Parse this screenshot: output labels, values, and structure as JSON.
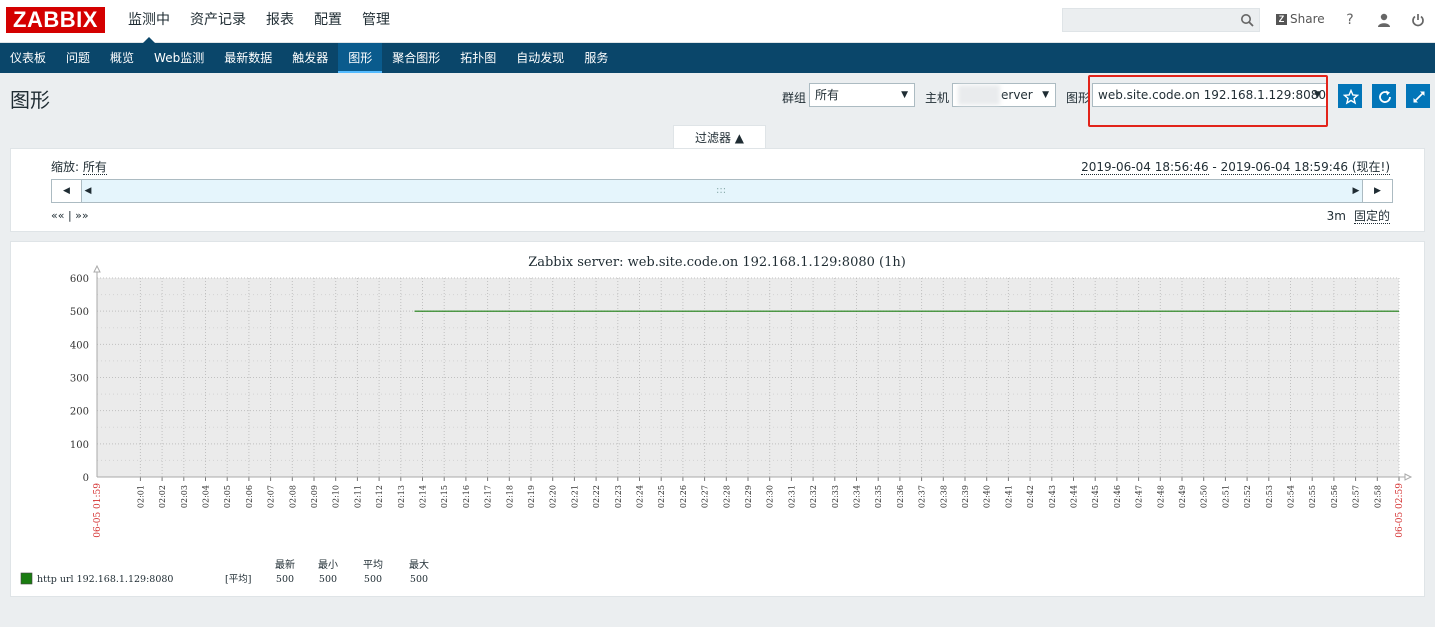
{
  "header": {
    "logo": "ZABBIX",
    "nav": [
      "监测中",
      "资产记录",
      "报表",
      "配置",
      "管理"
    ],
    "share_label": "Share",
    "help_label": "?"
  },
  "subnav": [
    "仪表板",
    "问题",
    "概览",
    "Web监测",
    "最新数据",
    "触发器",
    "图形",
    "聚合图形",
    "拓扑图",
    "自动发现",
    "服务"
  ],
  "page": {
    "title": "图形",
    "group_label": "群组",
    "group_value": "所有",
    "host_label": "主机",
    "host_value": "erver",
    "graph_label": "图形",
    "graph_value": "web.site.code.on 192.168.1.129:8080"
  },
  "filter": {
    "tab_label": "过滤器 ▲",
    "zoom_label": "缩放:",
    "zoom_value": "所有",
    "range_from": "2019-06-04 18:56:46",
    "range_sep": " - ",
    "range_to": "2019-06-04 18:59:46 (现在!)",
    "nav_arrows": "«« | »»",
    "period": "3m",
    "fixed_label": "固定的"
  },
  "chart_data": {
    "type": "line",
    "title": "Zabbix server: web.site.code.on 192.168.1.129:8080 (1h)",
    "ylim": [
      0,
      600
    ],
    "y_ticks": [
      "0",
      "100",
      "200",
      "300",
      "400",
      "500",
      "600"
    ],
    "x_start_label": "06-05 01:59",
    "x_end_label": "06-05 02:59",
    "x_ticks": [
      "02:01",
      "02:02",
      "02:03",
      "02:04",
      "02:05",
      "02:06",
      "02:07",
      "02:08",
      "02:09",
      "02:10",
      "02:11",
      "02:12",
      "02:13",
      "02:14",
      "02:15",
      "02:16",
      "02:17",
      "02:18",
      "02:19",
      "02:20",
      "02:21",
      "02:22",
      "02:23",
      "02:24",
      "02:25",
      "02:26",
      "02:27",
      "02:28",
      "02:29",
      "02:30",
      "02:31",
      "02:32",
      "02:33",
      "02:34",
      "02:35",
      "02:36",
      "02:37",
      "02:38",
      "02:39",
      "02:40",
      "02:41",
      "02:42",
      "02:43",
      "02:44",
      "02:45",
      "02:46",
      "02:47",
      "02:48",
      "02:49",
      "02:50",
      "02:51",
      "02:52",
      "02:53",
      "02:54",
      "02:55",
      "02:56",
      "02:57",
      "02:58",
      "02:59"
    ],
    "series": [
      {
        "name": "http url 192.168.1.129:8080",
        "color": "#1a7c11",
        "x_from": "02:13:38",
        "x_to": "02:59",
        "value": 500
      }
    ],
    "legend": {
      "headers": [
        "最新",
        "最小",
        "平均",
        "最大"
      ],
      "func": "[平均]",
      "values": [
        "500",
        "500",
        "500",
        "500"
      ]
    }
  }
}
